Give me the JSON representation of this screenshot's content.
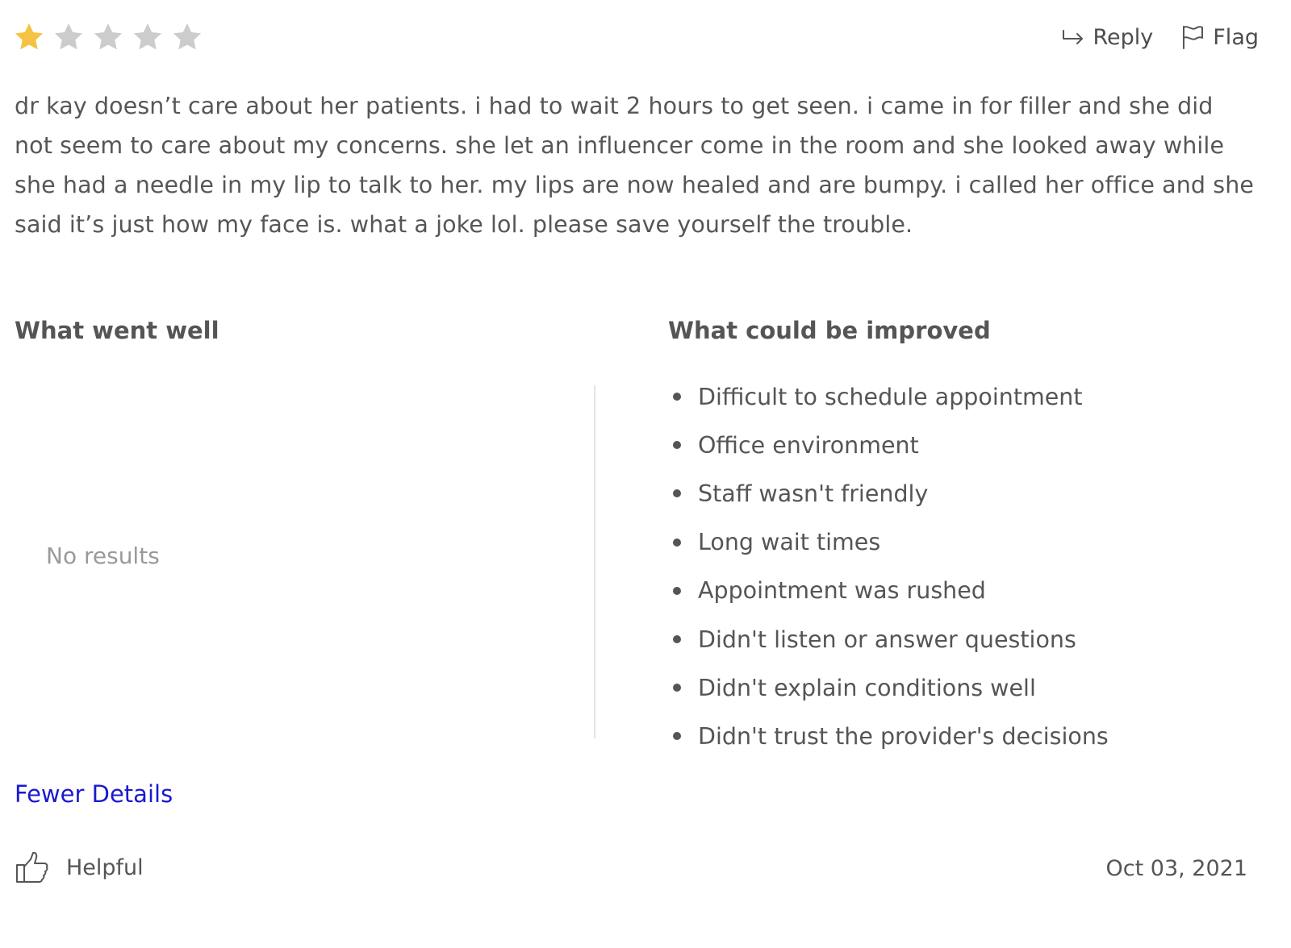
{
  "rating": {
    "value": 1,
    "max": 5,
    "filled_color": "#f5c242",
    "empty_color": "#cccccc"
  },
  "actions": {
    "reply_label": "Reply",
    "reply_icon": "reply-arrow-icon",
    "flag_label": "Flag",
    "flag_icon": "flag-icon"
  },
  "review": {
    "text": "dr kay doesn’t care about her patients. i had to wait 2 hours to get seen. i came in for filler and she did not seem to care about my concerns. she let an influencer come in the room and she looked away while she had a needle in my lip to talk to her. my lips are now healed and are bumpy. i called her office and she said it’s just how my face is. what a joke lol. please save yourself the trouble."
  },
  "went_well": {
    "title": "What went well",
    "empty_text": "No results"
  },
  "could_improve": {
    "title": "What could be improved",
    "items": [
      "Difficult to schedule appointment",
      "Office environment",
      "Staff wasn't friendly",
      "Long wait times",
      "Appointment was rushed",
      "Didn't listen or answer questions",
      "Didn't explain conditions well",
      "Didn't trust the provider's decisions"
    ]
  },
  "details_toggle": {
    "label": "Fewer Details",
    "color": "#1a1acf"
  },
  "footer": {
    "helpful_label": "Helpful",
    "helpful_icon": "thumbs-up-icon",
    "date": "Oct 03, 2021"
  }
}
